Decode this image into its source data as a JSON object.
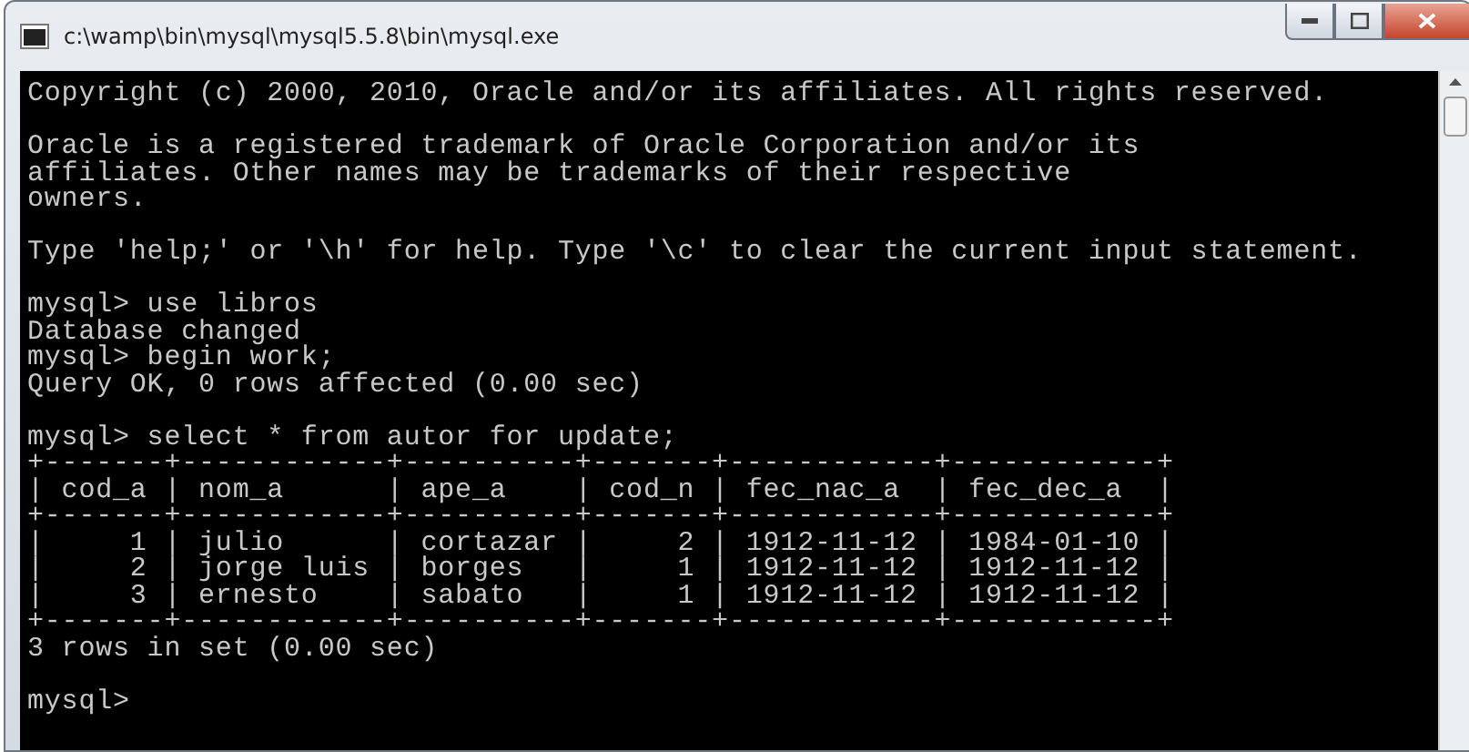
{
  "window": {
    "title": "c:\\wamp\\bin\\mysql\\mysql5.5.8\\bin\\mysql.exe"
  },
  "console": {
    "blocks": [
      [
        "Copyright (c) 2000, 2010, Oracle and/or its affiliates. All rights reserved."
      ],
      [
        "Oracle is a registered trademark of Oracle Corporation and/or its",
        "affiliates. Other names may be trademarks of their respective",
        "owners."
      ],
      [
        "Type 'help;' or '\\h' for help. Type '\\c' to clear the current input statement."
      ],
      [
        "mysql> use libros",
        "Database changed",
        "mysql> begin work;",
        "Query OK, 0 rows affected (0.00 sec)"
      ],
      [
        "mysql> select * from autor for update;",
        "+-------+------------+----------+-------+------------+------------+",
        "| cod_a | nom_a      | ape_a    | cod_n | fec_nac_a  | fec_dec_a  |",
        "+-------+------------+----------+-------+------------+------------+",
        "|     1 | julio      | cortazar |     2 | 1912-11-12 | 1984-01-10 |",
        "|     2 | jorge luis | borges   |     1 | 1912-11-12 | 1912-11-12 |",
        "|     3 | ernesto    | sabato   |     1 | 1912-11-12 | 1912-11-12 |",
        "+-------+------------+----------+-------+------------+------------+",
        "3 rows in set (0.00 sec)"
      ],
      [
        "mysql>"
      ]
    ]
  }
}
